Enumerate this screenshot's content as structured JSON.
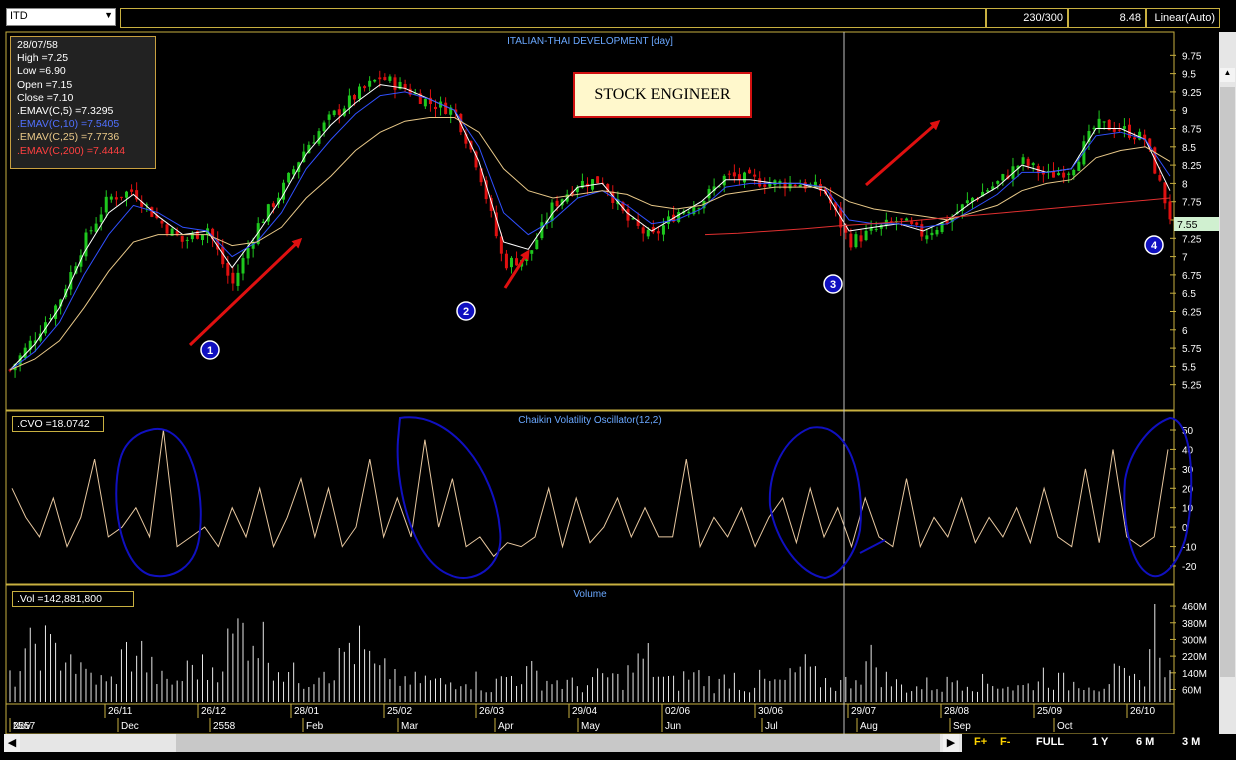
{
  "toolbar": {
    "symbol": "ITD",
    "count": "230/300",
    "last_price": "8.48",
    "scale_mode": "Linear(Auto)"
  },
  "info_box": {
    "date": "28/07/58",
    "high": "High  =7.25",
    "low": "Low   =6.90",
    "open": "Open  =7.15",
    "close": "Close  =7.10",
    "ema5": ".EMAV(C,5)   =7.3295",
    "ema10": ".EMAV(C,10)   =7.5405",
    "ema25": ".EMAV(C,25)   =7.7736",
    "ema200": ".EMAV(C,200)   =7.4444"
  },
  "overlay": {
    "title": "STOCK ENGINEER",
    "markers": [
      "1",
      "2",
      "3",
      "4"
    ]
  },
  "colors": {
    "up": "#1ec81e",
    "down": "#e01010",
    "ema5": "#ffffff",
    "ema10": "#3050ff",
    "ema25": "#e8c888",
    "ema200": "#e03030",
    "annotation": "#1010c0",
    "arrow": "#e01010"
  },
  "chart_data": [
    {
      "type": "line",
      "title": "ITALIAN-THAI DEVELOPMENT [day]",
      "price_label": "7.55",
      "y_ticks": [
        "9.75",
        "9.5",
        "9.25",
        "9",
        "8.75",
        "8.5",
        "8.25",
        "8",
        "7.75",
        "7.5",
        "7.25",
        "7",
        "6.75",
        "6.5",
        "6.25",
        "6",
        "5.75",
        "5.5",
        "5.25"
      ],
      "ylim": [
        5.15,
        9.85
      ],
      "x_ticks_top": [
        "26/11",
        "26/12",
        "28/01",
        "25/02",
        "26/03",
        "29/04",
        "02/06",
        "30/06",
        "29/07",
        "28/08",
        "25/09",
        "26/10"
      ],
      "x_ticks_bottom": [
        "2557",
        "Nov",
        "Dec",
        "2558",
        "Feb",
        "Mar",
        "Apr",
        "May",
        "Jun",
        "Jul",
        "Aug",
        "Sep",
        "Oct"
      ],
      "series": [
        {
          "name": "Close",
          "values": [
            5.45,
            5.9,
            6.4,
            7.2,
            7.8,
            7.9,
            7.5,
            7.2,
            7.4,
            6.6,
            7.4,
            7.9,
            8.5,
            8.9,
            9.2,
            9.45,
            9.3,
            9.1,
            9.0,
            8.2,
            6.9,
            7.0,
            7.7,
            8.0,
            8.05,
            7.5,
            7.25,
            7.6,
            7.75,
            8.1,
            8.05,
            8.0,
            8.0,
            7.9,
            7.2,
            7.35,
            7.5,
            7.3,
            7.5,
            7.8,
            8.0,
            8.3,
            8.1,
            8.2,
            8.8,
            8.75,
            8.6,
            7.55
          ]
        },
        {
          "name": ".EMAV(C,5)",
          "values": [
            5.45,
            5.8,
            6.3,
            7.05,
            7.6,
            7.85,
            7.55,
            7.3,
            7.35,
            6.85,
            7.3,
            7.8,
            8.4,
            8.8,
            9.1,
            9.35,
            9.3,
            9.15,
            9.0,
            8.3,
            7.2,
            7.1,
            7.6,
            7.95,
            8.0,
            7.6,
            7.35,
            7.55,
            7.75,
            8.05,
            8.05,
            8.0,
            8.0,
            7.9,
            7.35,
            7.4,
            7.45,
            7.35,
            7.5,
            7.75,
            7.95,
            8.25,
            8.15,
            8.2,
            8.75,
            8.75,
            8.6,
            7.9
          ]
        },
        {
          "name": ".EMAV(C,10)",
          "values": [
            5.45,
            5.7,
            6.1,
            6.75,
            7.3,
            7.7,
            7.6,
            7.4,
            7.35,
            7.0,
            7.2,
            7.6,
            8.2,
            8.6,
            8.95,
            9.2,
            9.25,
            9.15,
            9.0,
            8.5,
            7.6,
            7.3,
            7.5,
            7.8,
            7.9,
            7.7,
            7.45,
            7.5,
            7.65,
            7.95,
            8.0,
            8.0,
            8.0,
            7.95,
            7.5,
            7.45,
            7.45,
            7.4,
            7.45,
            7.65,
            7.85,
            8.15,
            8.15,
            8.2,
            8.65,
            8.7,
            8.6,
            8.1
          ]
        },
        {
          "name": ".EMAV(C,25)",
          "values": [
            5.45,
            5.6,
            5.85,
            6.3,
            6.8,
            7.2,
            7.3,
            7.3,
            7.3,
            7.15,
            7.2,
            7.4,
            7.8,
            8.1,
            8.45,
            8.7,
            8.85,
            8.9,
            8.9,
            8.7,
            8.2,
            7.9,
            7.8,
            7.85,
            7.9,
            7.85,
            7.7,
            7.65,
            7.7,
            7.85,
            7.9,
            7.95,
            7.95,
            7.95,
            7.75,
            7.65,
            7.6,
            7.55,
            7.5,
            7.6,
            7.7,
            7.9,
            8.0,
            8.05,
            8.35,
            8.45,
            8.5,
            8.3
          ]
        },
        {
          "name": ".EMAV(C,200)",
          "values": [
            7.3,
            7.32,
            7.35,
            7.38,
            7.42,
            7.45,
            7.48,
            7.52,
            7.56,
            7.6,
            7.64,
            7.68,
            7.72,
            7.76,
            7.8
          ]
        }
      ]
    },
    {
      "type": "line",
      "title": "Chaikin Volatility Oscillator(12,2)",
      "label": ".CVO   =18.0742",
      "y_ticks": [
        "50",
        "40",
        "30",
        "20",
        "10",
        "0",
        "-10",
        "-20"
      ],
      "ylim": [
        -25,
        55
      ],
      "series": [
        {
          "name": "CVO",
          "values": [
            20,
            5,
            -5,
            15,
            -10,
            5,
            35,
            -5,
            0,
            10,
            -5,
            50,
            -10,
            -5,
            0,
            -10,
            10,
            -5,
            20,
            -10,
            5,
            25,
            -5,
            20,
            -10,
            0,
            35,
            -5,
            15,
            -5,
            45,
            0,
            25,
            -10,
            -5,
            -15,
            -8,
            -10,
            -5,
            20,
            -10,
            15,
            -8,
            0,
            15,
            -5,
            10,
            -5,
            -5,
            35,
            -10,
            5,
            -5,
            10,
            -10,
            5,
            15,
            -8,
            20,
            -5,
            10,
            -10,
            15,
            -5,
            -10,
            25,
            -10,
            5,
            -5,
            15,
            -8,
            5,
            -5,
            10,
            -8,
            20,
            -5,
            -10,
            30,
            -8,
            40,
            -5,
            -10,
            -5,
            40
          ]
        }
      ]
    },
    {
      "type": "bar",
      "title": "Volume",
      "label": ".Vol   =142,881,800",
      "y_ticks": [
        "460M",
        "380M",
        "300M",
        "220M",
        "140M",
        "60M"
      ],
      "ylim": [
        0,
        490
      ],
      "series": [
        {
          "name": "Volume (M)",
          "values": [
            120,
            200,
            380,
            250,
            310,
            160,
            140,
            90,
            250,
            300,
            180,
            100,
            120,
            220,
            170,
            260,
            380,
            440,
            320,
            200,
            150,
            120,
            220,
            180,
            330,
            280,
            150,
            180,
            90,
            130,
            110,
            100,
            160,
            120,
            80,
            140,
            150,
            160,
            120,
            110,
            90,
            100,
            150,
            120,
            180,
            250,
            130,
            100,
            150,
            140,
            90,
            160,
            80,
            120,
            100,
            120,
            200,
            130,
            110,
            100,
            170,
            240,
            120,
            90,
            80,
            100,
            90,
            140,
            120,
            100,
            110,
            80,
            90,
            160,
            120,
            100,
            130,
            90,
            150,
            120,
            100,
            460,
            140
          ]
        }
      ]
    }
  ],
  "nav": {
    "buttons": [
      "F+",
      "F-",
      "FULL",
      "1 Y",
      "6 M",
      "3 M"
    ]
  }
}
